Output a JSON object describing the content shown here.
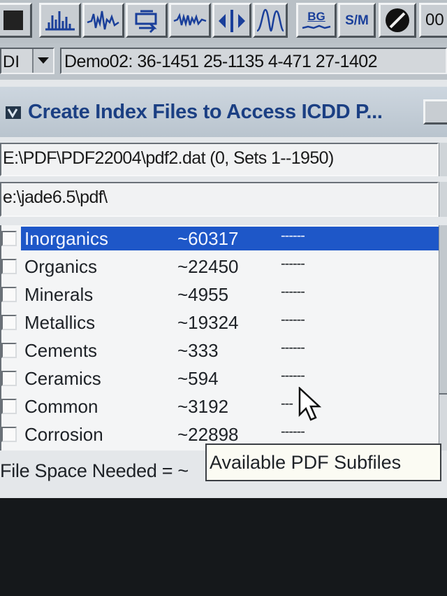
{
  "toolbar": {
    "bg_label": "BG",
    "sm_label": "S/M",
    "oo_label": "00"
  },
  "project": {
    "combo_value": "DI",
    "status_text": "Demo02: 36-1451 25-1135 4-471 27-1402"
  },
  "dialog": {
    "title": "Create Index Files to Access ICDD P...",
    "source_path": "E:\\PDF\\PDF22004\\pdf2.dat (0, Sets 1--1950)",
    "dest_path": "e:\\jade6.5\\pdf\\",
    "space_label": "File Space Needed = ~",
    "tooltip": "Available PDF Subfiles"
  },
  "subfiles": [
    {
      "name": "Inorganics",
      "count": "~60317",
      "status": "------",
      "selected": true
    },
    {
      "name": "Organics",
      "count": "~22450",
      "status": "------",
      "selected": false
    },
    {
      "name": "Minerals",
      "count": "~4955",
      "status": "------",
      "selected": false
    },
    {
      "name": "Metallics",
      "count": "~19324",
      "status": "------",
      "selected": false
    },
    {
      "name": "Cements",
      "count": "~333",
      "status": "------",
      "selected": false
    },
    {
      "name": "Ceramics",
      "count": "~594",
      "status": "------",
      "selected": false
    },
    {
      "name": "Common",
      "count": "~3192",
      "status": "---",
      "selected": false
    },
    {
      "name": "Corrosion",
      "count": "~22898",
      "status": "------",
      "selected": false
    }
  ],
  "icons": [
    "peaks-icon",
    "noisy-pattern-icon",
    "transform-icon",
    "smooth-icon",
    "compare-icon",
    "peak-profile-icon",
    "background-icon",
    "signal-noise-icon",
    "clear-icon"
  ],
  "colors": {
    "selection": "#1e57c8",
    "title_text": "#1b3f83",
    "toolbar_accent": "#1a3f9a"
  }
}
